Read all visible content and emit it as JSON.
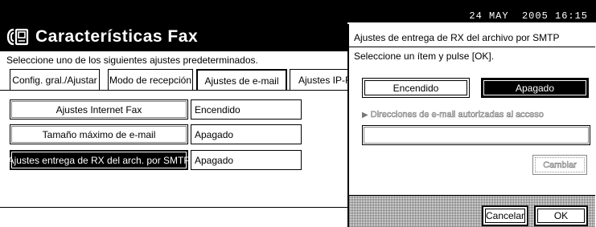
{
  "status_bar": {
    "datetime": "24 MAY  2005 16:15"
  },
  "header": {
    "title": "Características Fax",
    "icon": "fax-icon"
  },
  "instruction": "Seleccione uno de los siguientes ajustes predeterminados.",
  "tabs": [
    {
      "label": "Config. gral./Ajustar",
      "active": false
    },
    {
      "label": "Modo de recepción",
      "active": false
    },
    {
      "label": "Ajustes de e-mail",
      "active": true
    },
    {
      "label": "Ajustes IP-F",
      "active": false
    }
  ],
  "settings": [
    {
      "label": "Ajustes Internet Fax",
      "value": "Encendido",
      "selected": false
    },
    {
      "label": "Tamaño máximo de e-mail",
      "value": "Apagado",
      "selected": false
    },
    {
      "label": "Ajustes entrega de RX del arch. por SMTP",
      "value": "Apagado",
      "selected": true
    }
  ],
  "dialog": {
    "title": "Ajustes de entrega de RX del archivo por SMTP",
    "prompt": "Seleccione un ítem y pulse [OK].",
    "options": [
      {
        "label": "Encendido",
        "selected": false
      },
      {
        "label": "Apagado",
        "selected": true
      }
    ],
    "email_label": "Direcciones de e-mail autorizadas al acceso",
    "email_value": "",
    "change_label": "Cambiar",
    "cancel_label": "Cancelar",
    "ok_label": "OK"
  }
}
